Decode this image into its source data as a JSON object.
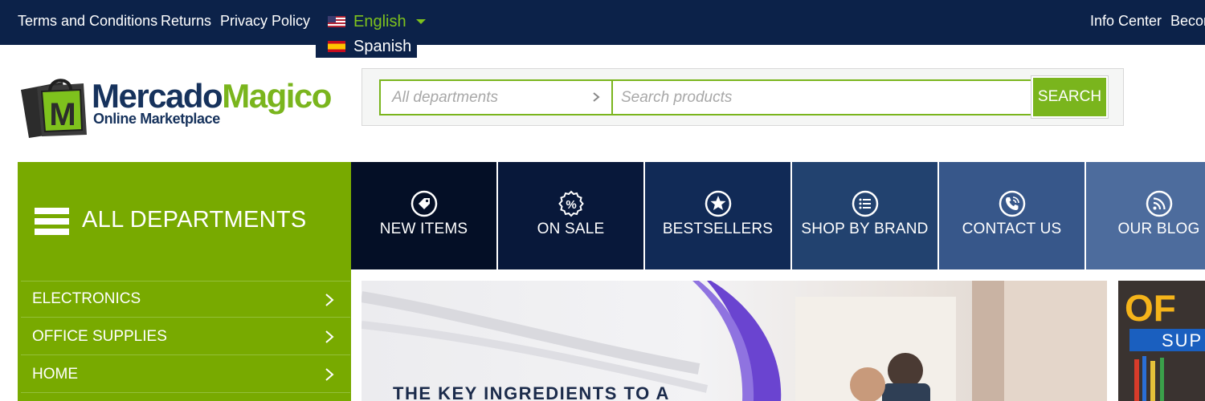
{
  "topbar": {
    "links": [
      "Terms and Conditions",
      "Returns",
      "Privacy Policy"
    ],
    "language": {
      "current": "English",
      "dropdown_option": "Spanish"
    },
    "right_links": [
      "Info Center",
      "Becom"
    ]
  },
  "logo": {
    "word1": "Mercado",
    "word2": "Magico",
    "tagline": "Online Marketplace",
    "bag_letter": "M"
  },
  "search": {
    "department_placeholder": "All departments",
    "input_placeholder": "Search products",
    "button_label": "SEARCH"
  },
  "departments": {
    "title": "ALL DEPARTMENTS",
    "items": [
      "ELECTRONICS",
      "OFFICE SUPPLIES",
      "HOME"
    ]
  },
  "nav": [
    {
      "label": "NEW ITEMS",
      "icon": "tag-icon",
      "color": "#040f26"
    },
    {
      "label": "ON SALE",
      "icon": "percent-badge-icon",
      "color": "#08183a"
    },
    {
      "label": "BESTSELLERS",
      "icon": "star-icon",
      "color": "#112a56"
    },
    {
      "label": "SHOP BY BRAND",
      "icon": "list-icon",
      "color": "#22426f"
    },
    {
      "label": "CONTACT US",
      "icon": "phone-icon",
      "color": "#37578a"
    },
    {
      "label": "OUR BLOG",
      "icon": "rss-icon",
      "color": "#4d6c9d"
    }
  ],
  "banner": {
    "headline": "THE KEY INGREDIENTS TO A"
  },
  "side_banner": {
    "text_top": "OF",
    "text_bottom": "SUP"
  },
  "colors": {
    "navy": "#0c2249",
    "green": "#7ab51d",
    "dept_green": "#78aa00"
  }
}
